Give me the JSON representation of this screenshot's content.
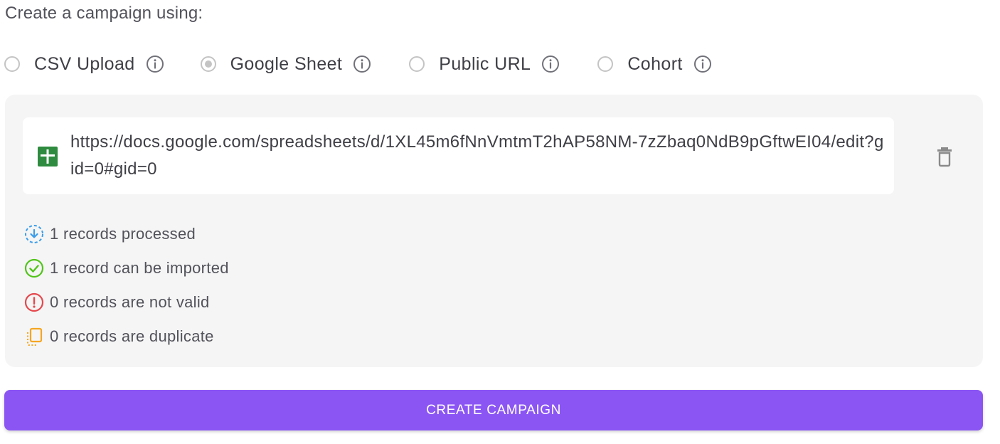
{
  "heading": "Create a campaign using:",
  "options": [
    {
      "label": "CSV Upload",
      "selected": false
    },
    {
      "label": "Google Sheet",
      "selected": true
    },
    {
      "label": "Public URL",
      "selected": false
    },
    {
      "label": "Cohort",
      "selected": false
    }
  ],
  "source": {
    "icon": "google-sheets-icon",
    "url": "https://docs.google.com/spreadsheets/d/1XL45m6fNnVmtmT2hAP58NM-7zZbaq0NdB9pGftwEI04/edit?gid=0#gid=0"
  },
  "stats": [
    {
      "icon": "download-circle-icon",
      "text": "1 records processed",
      "color": "#3b9dea"
    },
    {
      "icon": "check-circle-icon",
      "text": "1 record can be imported",
      "color": "#52c41a"
    },
    {
      "icon": "alert-circle-icon",
      "text": "0 records are not valid",
      "color": "#e5484d"
    },
    {
      "icon": "duplicate-icon",
      "text": "0 records are duplicate",
      "color": "#f5a623"
    }
  ],
  "actions": {
    "create_label": "CREATE CAMPAIGN"
  },
  "colors": {
    "accent": "#8b55f4",
    "panel_bg": "#f5f5f5",
    "sheet_green": "#2e8b3f"
  }
}
